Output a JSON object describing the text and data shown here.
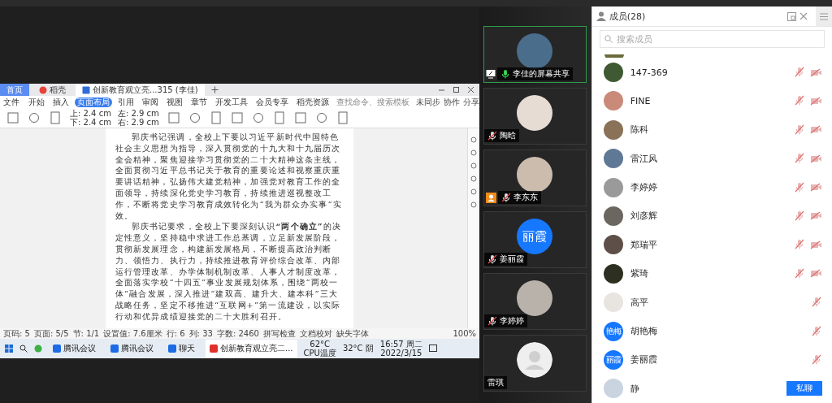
{
  "shared_screen": {
    "tabs": [
      {
        "label": "首页",
        "selected": false,
        "kind": "home"
      },
      {
        "label": "稻壳",
        "selected": false,
        "kind": "app"
      },
      {
        "label": "创新教育观立亮...315 (李佳)",
        "selected": true,
        "kind": "doc"
      }
    ],
    "menu_button": "文件",
    "menu_tabs": [
      {
        "label": "开始",
        "selected": false
      },
      {
        "label": "插入",
        "selected": false
      },
      {
        "label": "页面布局",
        "selected": true
      },
      {
        "label": "引用",
        "selected": false
      },
      {
        "label": "审阅",
        "selected": false
      },
      {
        "label": "视图",
        "selected": false
      },
      {
        "label": "章节",
        "selected": false
      },
      {
        "label": "开发工具",
        "selected": false
      },
      {
        "label": "会员专享",
        "selected": false
      },
      {
        "label": "稻壳资源",
        "selected": false
      }
    ],
    "command_search": {
      "placeholder": "查找命令、搜索模板"
    },
    "menu_actions": [
      "未同步",
      "协作",
      "分享"
    ],
    "margins": [
      "上: 2.4 cm",
      "左: 2.9 cm",
      "下: 2.4 cm",
      "右: 2.9 cm"
    ],
    "paragraphs": [
      "郭庆书记强调，全校上下要以习近平新时代中国特色社会主义思想为指导，深入贯彻党的十九大和十九届历次全会精神，聚焦迎接学习贯彻党的二十大精神这条主线，全面贯彻习近平总书记关于教育的重要论述和视察重庆重要讲话精神，弘扬伟大建党精神，加强党对教育工作的全面领导，持续深化党史学习教育，持续推进巡视整改工作，不断将党史学习教育成效转化为“我为群众办实事”实效。",
      "郭庆书记要求，全校上下要深刻认识**“两个确立”**的决定性意义，坚持稳中求进工作总基调，立足新发展阶段，贯彻新发展理念，构建新发展格局，不断提高政治判断力、领悟力、执行力，持续推进教育评价综合改革、内部运行管理改革、办学体制机制改革、人事人才制度改革，全面落实学校“十四五”事业发展规划体系，围绕“两校一体”融合发展，深入推进“建双高、建升大、建本科”三大战略任务，坚定不移推进“互联网+”第一流建设，以实际行动和优异成绩迎接党的二十大胜利召开。"
    ],
    "status_bar": [
      "页码: 5",
      "页面: 5/5",
      "节: 1/1",
      "设置值: 7.6厘米",
      "行: 6",
      "列: 33",
      "字数: 2460",
      "拼写检查",
      "文档校对",
      "缺失字体"
    ],
    "zoom": "100%",
    "taskbar": {
      "apps": [
        {
          "label": "腾讯会议",
          "kind": "meeting",
          "selected": false
        },
        {
          "label": "腾讯会议",
          "kind": "meeting",
          "selected": false
        },
        {
          "label": "聊天",
          "kind": "meeting",
          "selected": false
        },
        {
          "label": "创新教育观立亮二...",
          "kind": "wps",
          "selected": true
        }
      ],
      "cpu": [
        "62°C",
        "CPU温度"
      ],
      "weather": "32°C 阴",
      "clock": [
        "16:57 周二",
        "2022/3/15"
      ]
    }
  },
  "video_tiles": [
    {
      "name": "李佳的屏幕共享",
      "kind": "photo",
      "mic_muted": false,
      "screen_sharing": true,
      "host": false,
      "speaking": true
    },
    {
      "name": "陶晗",
      "kind": "photo",
      "mic_muted": true,
      "screen_sharing": false,
      "host": false,
      "speaking": false
    },
    {
      "name": "李东东",
      "kind": "photo",
      "mic_muted": true,
      "screen_sharing": false,
      "host": true,
      "speaking": false
    },
    {
      "name": "姜丽霞",
      "kind": "initials",
      "avatar_text": "丽霞",
      "mic_muted": true,
      "screen_sharing": false,
      "host": false,
      "speaking": false
    },
    {
      "name": "李婷婷",
      "kind": "photo",
      "mic_muted": true,
      "screen_sharing": false,
      "host": false,
      "speaking": false
    },
    {
      "name": "雷琪",
      "kind": "default",
      "screen_sharing": false,
      "host": false,
      "speaking": false
    }
  ],
  "members": {
    "title": "成员(28)",
    "search": {
      "placeholder": "搜索成员"
    },
    "rows": [
      {
        "name": "147-369",
        "kind": "photo",
        "color": "#3f5a33",
        "mic_muted": true,
        "video_off": true
      },
      {
        "name": "FINE",
        "kind": "photo",
        "color": "#c98a7a",
        "mic_muted": true,
        "video_off": true
      },
      {
        "name": "陈科",
        "kind": "photo",
        "color": "#8a7258",
        "mic_muted": true,
        "video_off": true
      },
      {
        "name": "雷江风",
        "kind": "photo",
        "color": "#5f7896",
        "mic_muted": true,
        "video_off": true
      },
      {
        "name": "李婷婷",
        "kind": "photo",
        "color": "#9a9a9a",
        "mic_muted": true,
        "video_off": true
      },
      {
        "name": "刘彦辉",
        "kind": "photo",
        "color": "#6b6660",
        "mic_muted": true,
        "video_off": true
      },
      {
        "name": "郑瑞平",
        "kind": "photo",
        "color": "#5e5048",
        "mic_muted": true,
        "video_off": true
      },
      {
        "name": "紫琦",
        "kind": "photo",
        "color": "#2d3020",
        "mic_muted": true,
        "video_off": true
      },
      {
        "name": "高平",
        "kind": "photo",
        "color": "#e8e4e0",
        "mic_muted": true,
        "video_off": false
      },
      {
        "name": "胡艳梅",
        "kind": "initials",
        "avatar_text": "艳梅",
        "color": "#1677ff",
        "mic_muted": true,
        "video_off": false
      },
      {
        "name": "姜丽霞",
        "kind": "initials",
        "avatar_text": "丽霞",
        "color": "#1677ff",
        "mic_muted": true,
        "video_off": false
      },
      {
        "name": "静",
        "kind": "photo",
        "color": "#c9d4e0",
        "mic_muted": false,
        "video_off": false,
        "action": "私聊"
      }
    ]
  }
}
